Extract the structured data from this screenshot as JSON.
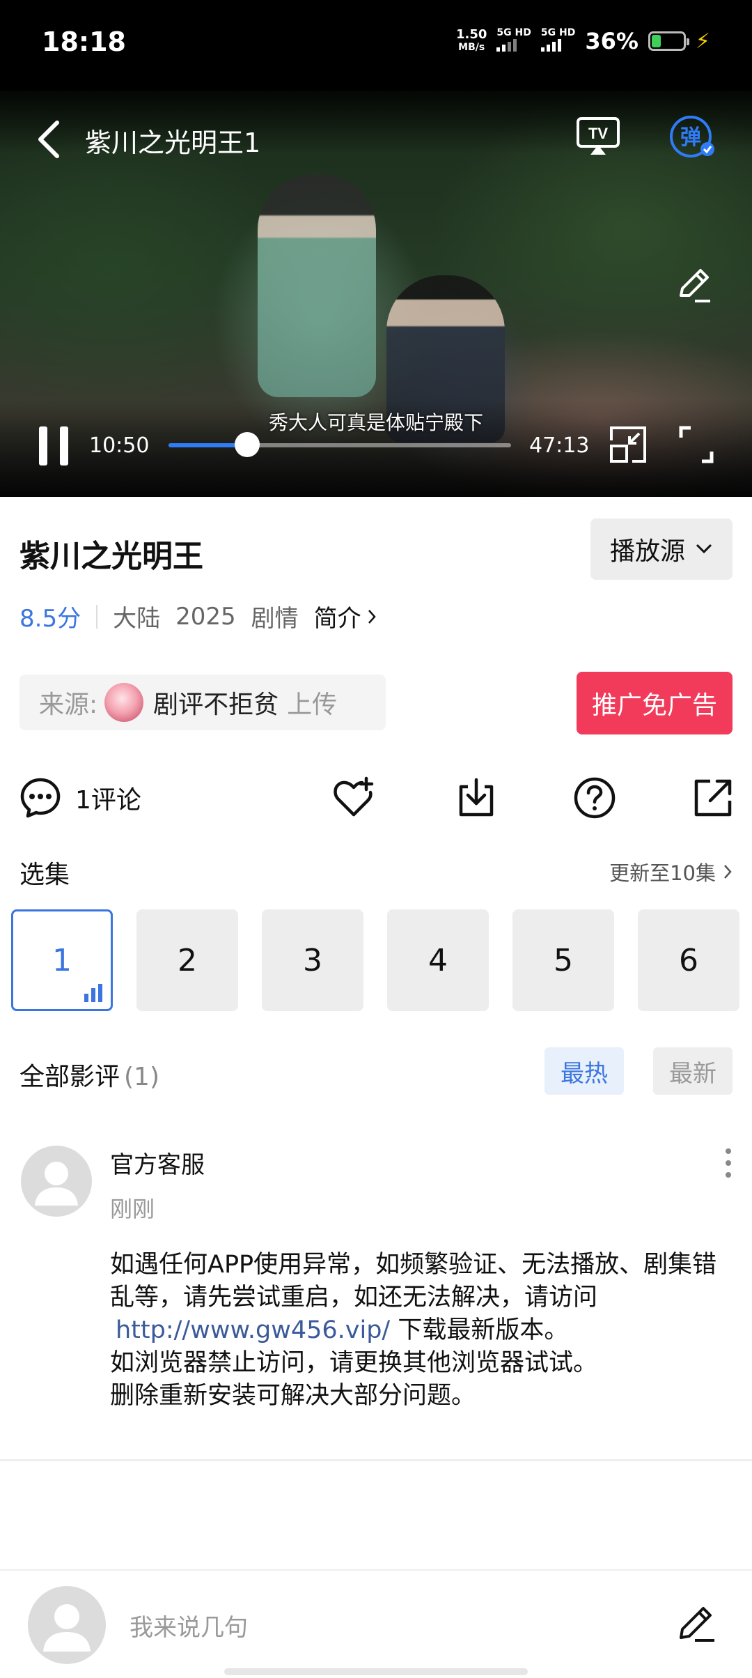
{
  "status_bar": {
    "time": "18:18",
    "net_speed": "1.50",
    "net_speed_unit": "MB/s",
    "sim1": "5G HD",
    "sim2": "5G HD",
    "battery_pct": "36%",
    "battery_level": 0.36
  },
  "player": {
    "episode_title": "紫川之光明王1",
    "subtitle": "秀大人可真是体贴宁殿下",
    "current_time": "10:50",
    "total_time": "47:13",
    "progress": 0.229,
    "tv_label": "TV",
    "danmu_label": "弹"
  },
  "info": {
    "title": "紫川之光明王",
    "source_button": "播放源",
    "score": "8.5分",
    "region": "大陆",
    "year": "2025",
    "genre": "剧情",
    "intro_label": "简介"
  },
  "uploader": {
    "label": "来源:",
    "name": "剧评不拒贫",
    "action": "上传",
    "promo_button": "推广免广告"
  },
  "actions": {
    "comment_label": "1评论"
  },
  "episodes": {
    "title": "选集",
    "update_text": "更新至10集",
    "items": [
      "1",
      "2",
      "3",
      "4",
      "5",
      "6"
    ],
    "active_index": 0
  },
  "reviews": {
    "title": "全部影评",
    "count": "(1)",
    "sort_hot": "最热",
    "sort_new": "最新",
    "comment": {
      "author": "官方客服",
      "time": "刚刚",
      "line1": "如遇任何APP使用异常，如频繁验证、无法播放、剧集错乱等，请先尝试重启，如还无法解决，请访问",
      "link": "http://www.gw456.vip/",
      "line1_after": " 下载最新版本。",
      "line2": "如浏览器禁止访问，请更换其他浏览器试试。",
      "line3": "删除重新安装可解决大部分问题。"
    }
  },
  "composer": {
    "placeholder": "我来说几句"
  },
  "colors": {
    "accent": "#3a75e0",
    "promo": "#f23b5a",
    "progress": "#2f7cf6"
  }
}
